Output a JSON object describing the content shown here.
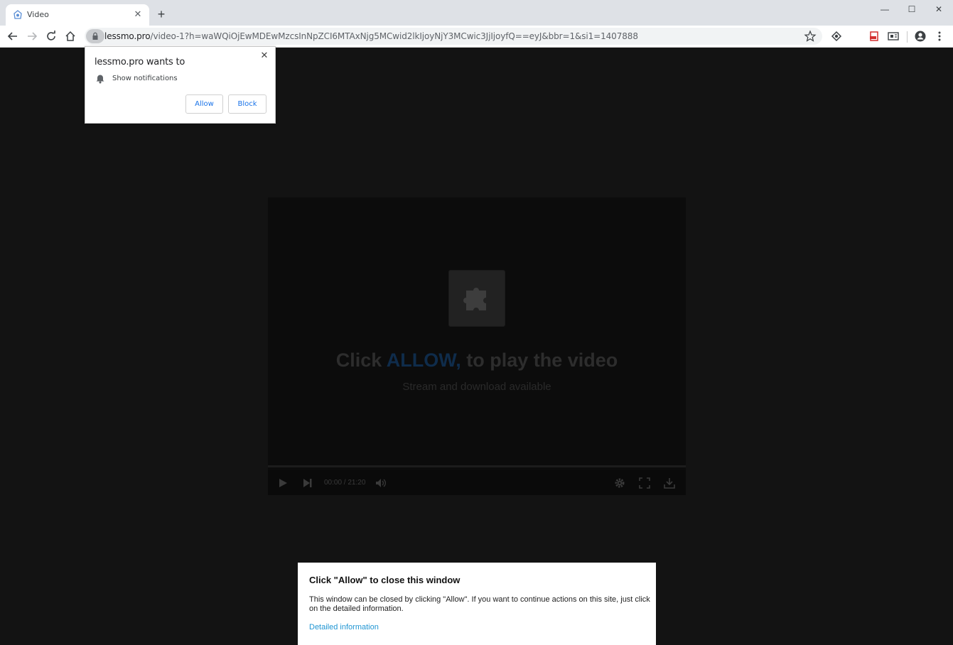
{
  "browser": {
    "tab_title": "Video",
    "tab_close": "✕",
    "new_tab": "+",
    "url_host": "lessmo.pro",
    "url_rest": "/video-1?h=waWQiOjEwMDEwMzcsInNpZCI6MTAxNjg5MCwid2lkIjoyNjY3MCwic3JjIjoyfQ==eyJ&bbr=1&si1=1407888",
    "window_minimize": "—",
    "window_maximize": "☐",
    "window_close": "✕"
  },
  "permission_popup": {
    "title": "lessmo.pro wants to",
    "permission": "Show notifications",
    "allow_label": "Allow",
    "block_label": "Block",
    "close": "✕"
  },
  "player": {
    "headline_pre": "Click ",
    "headline_accent": "ALLOW,",
    "headline_post": " to play the video",
    "subline": "Stream and download available",
    "time": "00:00 / 21:20"
  },
  "dialog": {
    "title": "Click \"Allow\" to close this window",
    "body": "This window can be closed by clicking \"Allow\". If you want to continue actions on this site, just click on the detailed information.",
    "link": "Detailed information"
  },
  "colors": {
    "accent_blue": "#1a73e8",
    "link_blue": "#2196d3",
    "page_bg": "#131313"
  },
  "icons": [
    "favicon-icon",
    "close-icon",
    "plus-icon",
    "back-icon",
    "forward-icon",
    "reload-icon",
    "home-icon",
    "lock-icon",
    "star-icon",
    "extension-icon",
    "pdf-icon",
    "translate-icon",
    "account-icon",
    "menu-icon",
    "bell-icon",
    "puzzle-icon",
    "play-icon",
    "next-icon",
    "volume-icon",
    "gear-icon",
    "fullscreen-icon",
    "download-icon"
  ]
}
